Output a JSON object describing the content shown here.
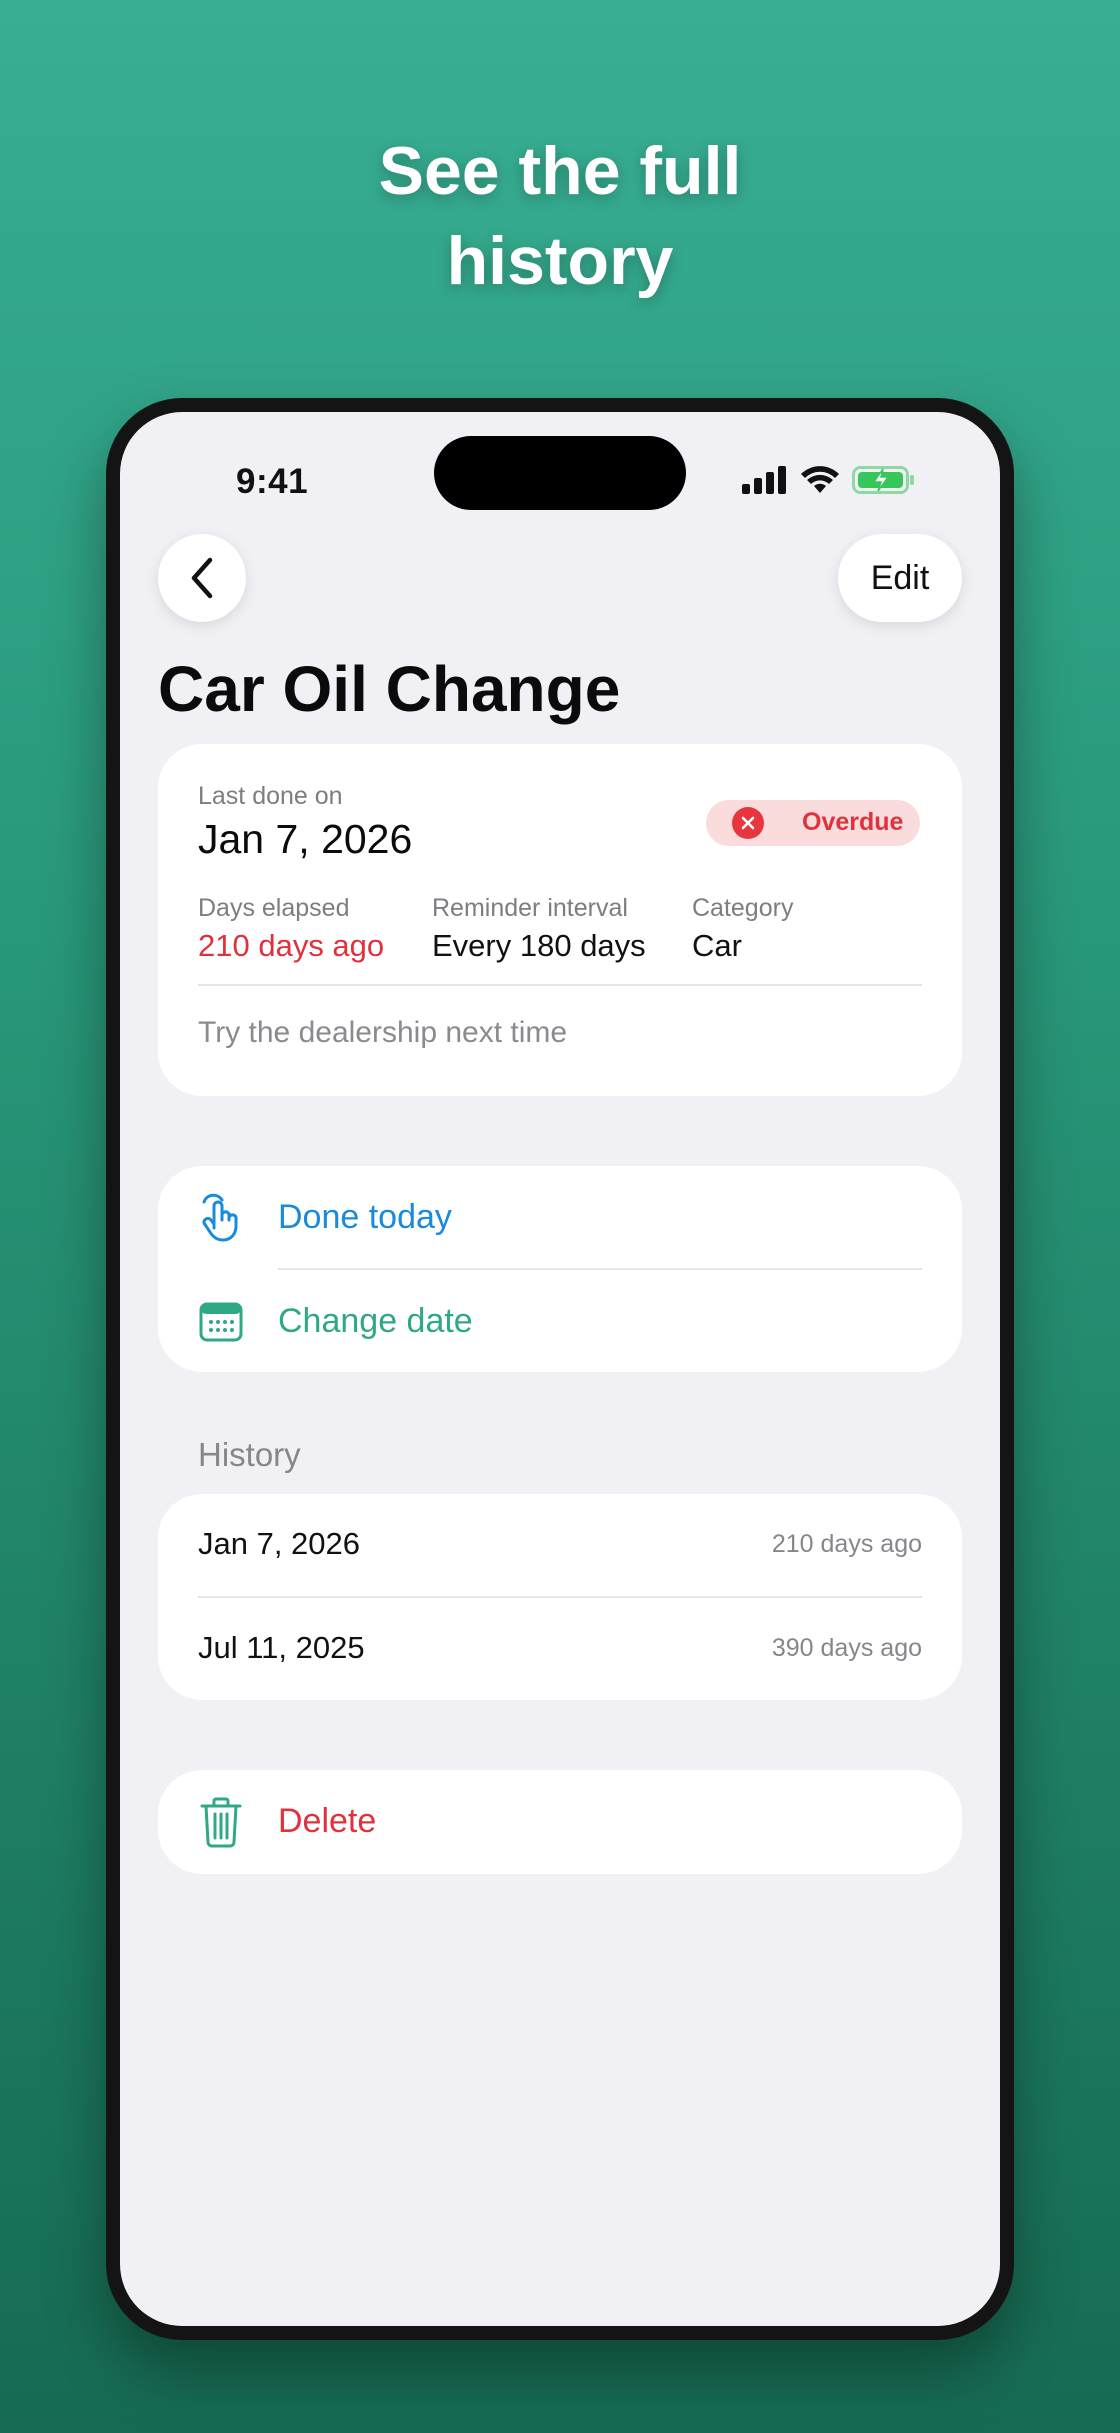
{
  "headline": {
    "line1": "See the full",
    "line2": "history"
  },
  "status_bar": {
    "time": "9:41"
  },
  "nav": {
    "edit_label": "Edit"
  },
  "page_title": "Car Oil Change",
  "info": {
    "last_done_label": "Last done on",
    "last_done_value": "Jan 7, 2026",
    "status_badge": "Overdue",
    "days_elapsed_label": "Days elapsed",
    "days_elapsed_value": "210 days ago",
    "interval_label": "Reminder interval",
    "interval_value": "Every 180 days",
    "category_label": "Category",
    "category_value": "Car",
    "note": "Try the dealership next time"
  },
  "actions": {
    "done_today": "Done today",
    "change_date": "Change date"
  },
  "history": {
    "title": "History",
    "items": [
      {
        "date": "Jan 7, 2026",
        "ago": "210 days ago"
      },
      {
        "date": "Jul 11, 2025",
        "ago": "390 days ago"
      }
    ]
  },
  "delete_label": "Delete",
  "colors": {
    "accent_green": "#2fa886",
    "accent_blue": "#1a8bdc",
    "danger_red": "#e0323c",
    "background_top": "#38ae93",
    "background_bottom": "#166a53"
  }
}
